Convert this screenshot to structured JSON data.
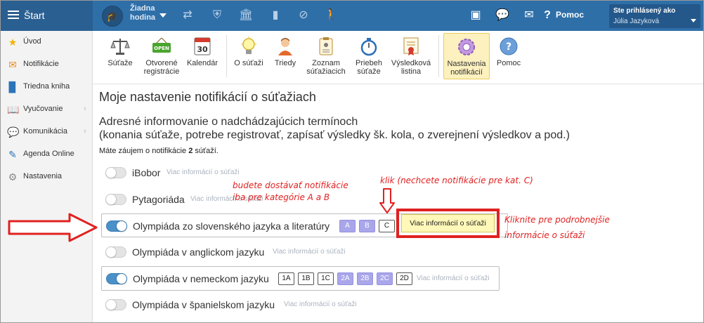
{
  "topbar": {
    "start_label": "Štart",
    "hour_text": "Žiadna hodina",
    "help_label": "Pomoc",
    "user_title": "Ste prihlásený ako",
    "user_name": "Júlia Jazyková",
    "icons": [
      "hat-icon",
      "transfer-icon",
      "shield-icon",
      "building-icon",
      "chart-icon",
      "no-sign-icon",
      "walk-icon",
      "screen-icon",
      "chat-icon",
      "mail-icon",
      "help-icon"
    ]
  },
  "sidebar": {
    "items": [
      {
        "label": "Úvod",
        "icon": "star-icon",
        "color": "#f0b400"
      },
      {
        "label": "Notifikácie",
        "icon": "envelope-icon",
        "color": "#e98b1e"
      },
      {
        "label": "Triedna kniha",
        "icon": "book-icon",
        "color": "#2c73b8"
      },
      {
        "label": "Vyučovanie",
        "icon": "open-book-icon",
        "color": "#2c73b8"
      },
      {
        "label": "Komunikácia",
        "icon": "chat-icon",
        "color": "#d8412f"
      },
      {
        "label": "Agenda Online",
        "icon": "pen-icon",
        "color": "#2c73b8"
      },
      {
        "label": "Nastavenia",
        "icon": "gear-icon",
        "color": "#888888"
      }
    ]
  },
  "toolbar": {
    "tools": [
      {
        "label_1": "Súťaže",
        "label_2": "",
        "icon": "scales-icon"
      },
      {
        "label_1": "Otvorené",
        "label_2": "registrácie",
        "icon": "open-sign-icon",
        "badge": "OPEN"
      },
      {
        "label_1": "Kalendár",
        "label_2": "",
        "icon": "calendar-icon",
        "badge": "30"
      },
      {
        "label_1": "O súťaži",
        "label_2": "",
        "icon": "lightbulb-icon"
      },
      {
        "label_1": "Triedy",
        "label_2": "",
        "icon": "person-icon"
      },
      {
        "label_1": "Zoznam",
        "label_2": "súťažiacich",
        "icon": "clipboard-icon"
      },
      {
        "label_1": "Priebeh",
        "label_2": "súťaže",
        "icon": "stopwatch-icon"
      },
      {
        "label_1": "Výsledková",
        "label_2": "listina",
        "icon": "certificate-icon"
      },
      {
        "label_1": "Nastavenia",
        "label_2": "notifikácií",
        "icon": "gear-icon"
      },
      {
        "label_1": "Pomoc",
        "label_2": "",
        "icon": "help-circle-icon"
      }
    ]
  },
  "main": {
    "title": "Moje nastavenie notifikácií o súťažiach",
    "subtitle_1": "Adresné informovanie o nadchádzajúcich termínoch",
    "subtitle_2": "(konania súťaže, potrebe registrovať, zapísať výsledky šk. kola, o zverejnení výsledkov a pod.)",
    "interest_prefix": "Máte záujem o notifikácie",
    "interest_count": "2",
    "interest_suffix": "súťaží.",
    "more_info": "Viac informácií o súťaži",
    "rows": [
      {
        "name": "iBobor",
        "on": false,
        "boxed": false,
        "cats": []
      },
      {
        "name": "Pytagoriáda",
        "on": false,
        "boxed": false,
        "cats": []
      },
      {
        "name": "Olympiáda zo slovenského jazyka a literatúry",
        "on": true,
        "boxed": true,
        "cats": [
          {
            "l": "A",
            "sel": true
          },
          {
            "l": "B",
            "sel": true
          },
          {
            "l": "C",
            "sel": false
          }
        ]
      },
      {
        "name": "Olympiáda v anglickom jazyku",
        "on": false,
        "boxed": false,
        "cats": []
      },
      {
        "name": "Olympiáda v nemeckom jazyku",
        "on": true,
        "boxed": true,
        "cats": [
          {
            "l": "1A",
            "sel": false
          },
          {
            "l": "1B",
            "sel": false
          },
          {
            "l": "1C",
            "sel": false
          },
          {
            "l": "2A",
            "sel": true
          },
          {
            "l": "2B",
            "sel": true
          },
          {
            "l": "2C",
            "sel": true
          },
          {
            "l": "2D",
            "sel": false
          }
        ]
      },
      {
        "name": "Olympiáda v španielskom jazyku",
        "on": false,
        "boxed": false,
        "cats": []
      }
    ]
  },
  "annotations": {
    "note_categories_1": "budete dostávať notifikácie",
    "note_categories_2": "iba pre kategórie A a B",
    "note_click": "klik (nechcete notifikácie pre kat. C)",
    "note_more_1": "Kliknite pre podrobnejšie",
    "note_more_2": "informácie o súťaži"
  },
  "colors": {
    "accent": "#2f6fa8",
    "selected_cat": "#a9a6ea",
    "annotation": "#e02121",
    "toggle_on": "#4a90c9"
  }
}
